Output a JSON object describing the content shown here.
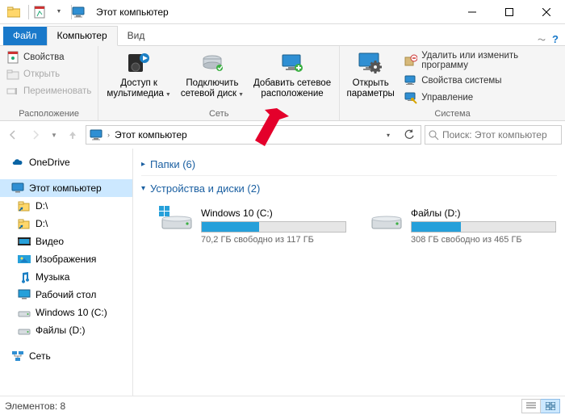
{
  "window": {
    "title": "Этот компьютер"
  },
  "tabs": {
    "file": "Файл",
    "computer": "Компьютер",
    "view": "Вид"
  },
  "ribbon": {
    "location": {
      "properties": "Свойства",
      "open": "Открыть",
      "rename": "Переименовать",
      "group_label": "Расположение"
    },
    "network": {
      "media_access_l1": "Доступ к",
      "media_access_l2": "мультимедиа",
      "map_drive_l1": "Подключить",
      "map_drive_l2": "сетевой диск",
      "add_netloc_l1": "Добавить сетевое",
      "add_netloc_l2": "расположение",
      "group_label": "Сеть"
    },
    "system": {
      "open_params_l1": "Открыть",
      "open_params_l2": "параметры",
      "uninstall": "Удалить или изменить программу",
      "sysprops": "Свойства системы",
      "manage": "Управление",
      "group_label": "Система"
    }
  },
  "address": {
    "path": "Этот компьютер",
    "search_placeholder": "Поиск: Этот компьютер"
  },
  "sidebar": {
    "onedrive": "OneDrive",
    "thispc": "Этот компьютер",
    "items": [
      {
        "label": "D:\\",
        "icon": "folder-shortcut"
      },
      {
        "label": "D:\\",
        "icon": "folder-shortcut"
      },
      {
        "label": "Видео",
        "icon": "folder-video"
      },
      {
        "label": "Изображения",
        "icon": "folder-pictures"
      },
      {
        "label": "Музыка",
        "icon": "folder-music"
      },
      {
        "label": "Рабочий стол",
        "icon": "folder-desktop"
      },
      {
        "label": "Windows 10 (C:)",
        "icon": "drive"
      },
      {
        "label": "Файлы (D:)",
        "icon": "drive"
      }
    ],
    "network": "Сеть"
  },
  "content": {
    "folders_header": "Папки (6)",
    "drives_header": "Устройства и диски (2)",
    "drives": [
      {
        "name": "Windows 10 (C:)",
        "free_text": "70,2 ГБ свободно из 117 ГБ",
        "fill_pct": 40,
        "os": true
      },
      {
        "name": "Файлы (D:)",
        "free_text": "308 ГБ свободно из 465 ГБ",
        "fill_pct": 34,
        "os": false
      }
    ]
  },
  "status": {
    "elements": "Элементов: 8"
  }
}
